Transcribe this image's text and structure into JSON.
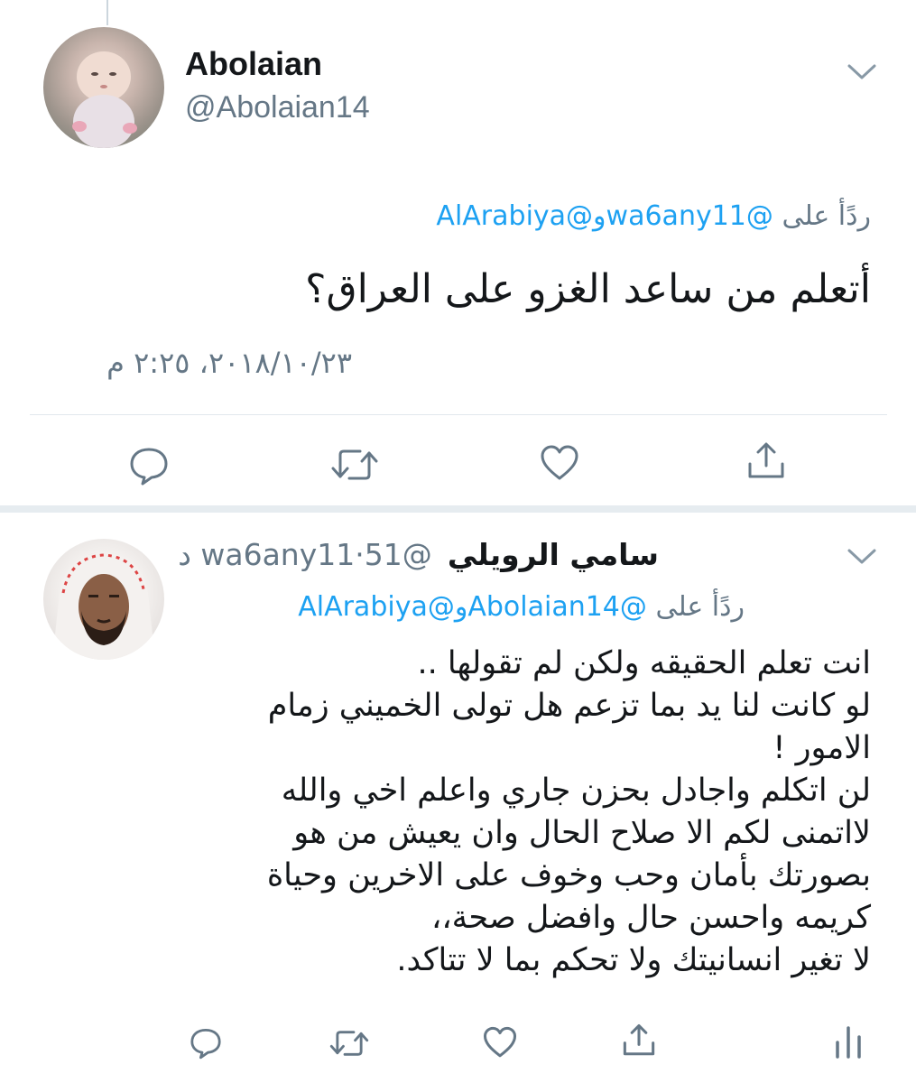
{
  "tweet1": {
    "display_name": "Abolaian",
    "handle": "@Abolaian14",
    "reply_prefix": "ردًأ على",
    "reply_mention_1": "@wa6any11",
    "reply_conj": "و",
    "reply_mention_2": "@AlArabiya",
    "text": "أتعلم من ساعد الغزو على العراق؟",
    "timestamp": "٢٠١٨/١٠/٢٣، ٢:٢٥ م",
    "icons": [
      "reply-icon",
      "retweet-icon",
      "like-icon",
      "share-icon",
      "chevron-down-icon"
    ]
  },
  "tweet2": {
    "display_name": "سامي الرويلي",
    "handle": "@wa6any11",
    "time_ago": "51 د",
    "dot": "·",
    "reply_prefix": "ردًأ على",
    "reply_mention_1": "@Abolaian14",
    "reply_conj": "و",
    "reply_mention_2": "@AlArabiya",
    "lines": [
      "انت تعلم الحقيقه ولكن لم تقولها ..",
      "لو كانت لنا يد بما تزعم هل تولى الخميني زمام",
      "الامور !",
      "لن اتكلم واجادل بحزن جاري واعلم اخي والله",
      "لااتمنى لكم الا صلاح الحال وان يعيش من هو",
      "بصورتك بأمان وحب وخوف على الاخرين وحياة",
      "كريمه واحسن حال وافضل صحة،،",
      "لا تغير انسانيتك ولا تحكم بما لا تتاكد."
    ],
    "icons": [
      "reply-icon",
      "retweet-icon",
      "like-icon",
      "share-icon",
      "analytics-icon",
      "chevron-down-icon"
    ]
  },
  "colors": {
    "accent": "#1da1f2",
    "text": "#14171a",
    "secondary": "#657786",
    "divider": "#e1e8ed"
  }
}
